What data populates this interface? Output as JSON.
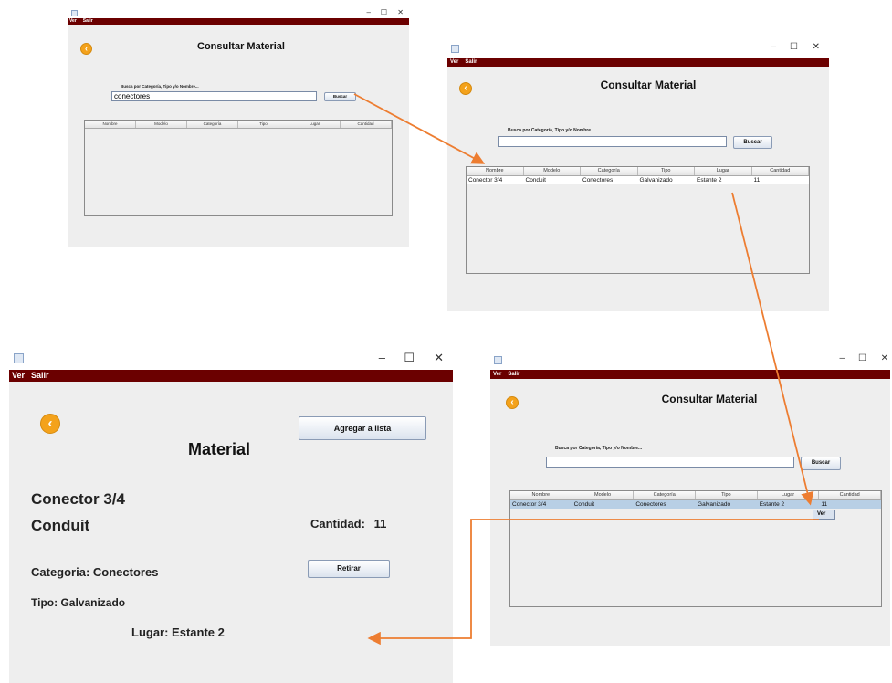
{
  "app": {
    "menu": [
      "Ver",
      "Salir"
    ],
    "window_controls": [
      "–",
      "☐",
      "✕"
    ]
  },
  "search_screen": {
    "title": "Consultar Material",
    "search_label": "Busca por Categoría, Tipo y/o Nombre...",
    "search_button": "Buscar",
    "columns": [
      "Nombre",
      "Modelo",
      "Categoría",
      "Tipo",
      "Lugar",
      "Cantidad"
    ]
  },
  "step1": {
    "search_value": "conectores"
  },
  "result_row": [
    "Conector 3/4",
    "Conduit",
    "Conectores",
    "Galvanizado",
    "Estante 2",
    "11"
  ],
  "context_menu": {
    "item": "Ver"
  },
  "detail": {
    "title": "Material",
    "add_button": "Agregar a lista",
    "name": "Conector 3/4",
    "model": "Conduit",
    "quantity_label": "Cantidad:",
    "quantity_value": "11",
    "category": "Categoria: Conectores",
    "withdraw_button": "Retirar",
    "type": "Tipo: Galvanizado",
    "location": "Lugar: Estante 2"
  },
  "colors": {
    "menubar": "#6b0000",
    "arrow": "#ed7d31",
    "back_icon": "#f4a21b",
    "selection": "#b8cfe5"
  }
}
